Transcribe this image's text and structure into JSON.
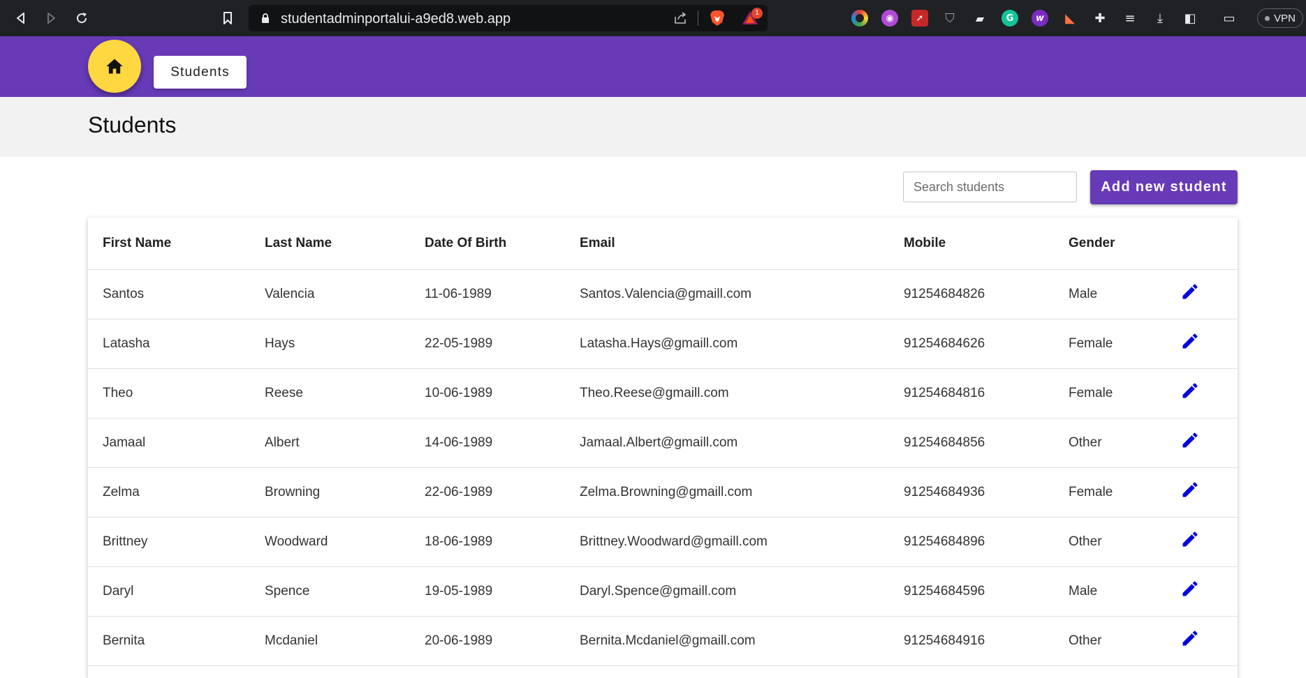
{
  "browser": {
    "url": "studentadminportalui-a9ed8.web.app",
    "bat_badge": "1",
    "vpn_label": "VPN",
    "extensions": [
      "colorzilla-icon",
      "crypto-ext-icon",
      "rocket-ext-icon",
      "shield-ext-icon",
      "cat-ext-icon",
      "grammarly-icon",
      "wordtune-icon",
      "pdf-ext-icon",
      "puzzle-icon",
      "media-list-icon",
      "download-icon",
      "sidebar-icon",
      "wallet-icon"
    ]
  },
  "header": {
    "home_icon": "home-icon",
    "nav_students_label": "Students",
    "accent_color": "#673ab7",
    "fab_color": "#ffd740"
  },
  "page": {
    "title": "Students"
  },
  "toolbar": {
    "search_placeholder": "Search students",
    "search_value": "",
    "add_button_label": "Add new student"
  },
  "table": {
    "columns": [
      "First Name",
      "Last Name",
      "Date Of Birth",
      "Email",
      "Mobile",
      "Gender"
    ],
    "edit_icon": "pencil-icon",
    "edit_icon_color": "#0000e0",
    "rows": [
      {
        "first": "Santos",
        "last": "Valencia",
        "dob": "11-06-1989",
        "email": "Santos.Valencia@gmaill.com",
        "mobile": "91254684826",
        "gender": "Male"
      },
      {
        "first": "Latasha",
        "last": "Hays",
        "dob": "22-05-1989",
        "email": "Latasha.Hays@gmaill.com",
        "mobile": "91254684626",
        "gender": "Female"
      },
      {
        "first": "Theo",
        "last": "Reese",
        "dob": "10-06-1989",
        "email": "Theo.Reese@gmaill.com",
        "mobile": "91254684816",
        "gender": "Female"
      },
      {
        "first": "Jamaal",
        "last": "Albert",
        "dob": "14-06-1989",
        "email": "Jamaal.Albert@gmaill.com",
        "mobile": "91254684856",
        "gender": "Other"
      },
      {
        "first": "Zelma",
        "last": "Browning",
        "dob": "22-06-1989",
        "email": "Zelma.Browning@gmaill.com",
        "mobile": "91254684936",
        "gender": "Female"
      },
      {
        "first": "Brittney",
        "last": "Woodward",
        "dob": "18-06-1989",
        "email": "Brittney.Woodward@gmaill.com",
        "mobile": "91254684896",
        "gender": "Other"
      },
      {
        "first": "Daryl",
        "last": "Spence",
        "dob": "19-05-1989",
        "email": "Daryl.Spence@gmaill.com",
        "mobile": "91254684596",
        "gender": "Male"
      },
      {
        "first": "Bernita",
        "last": "Mcdaniel",
        "dob": "20-06-1989",
        "email": "Bernita.Mcdaniel@gmaill.com",
        "mobile": "91254684916",
        "gender": "Other"
      }
    ]
  }
}
